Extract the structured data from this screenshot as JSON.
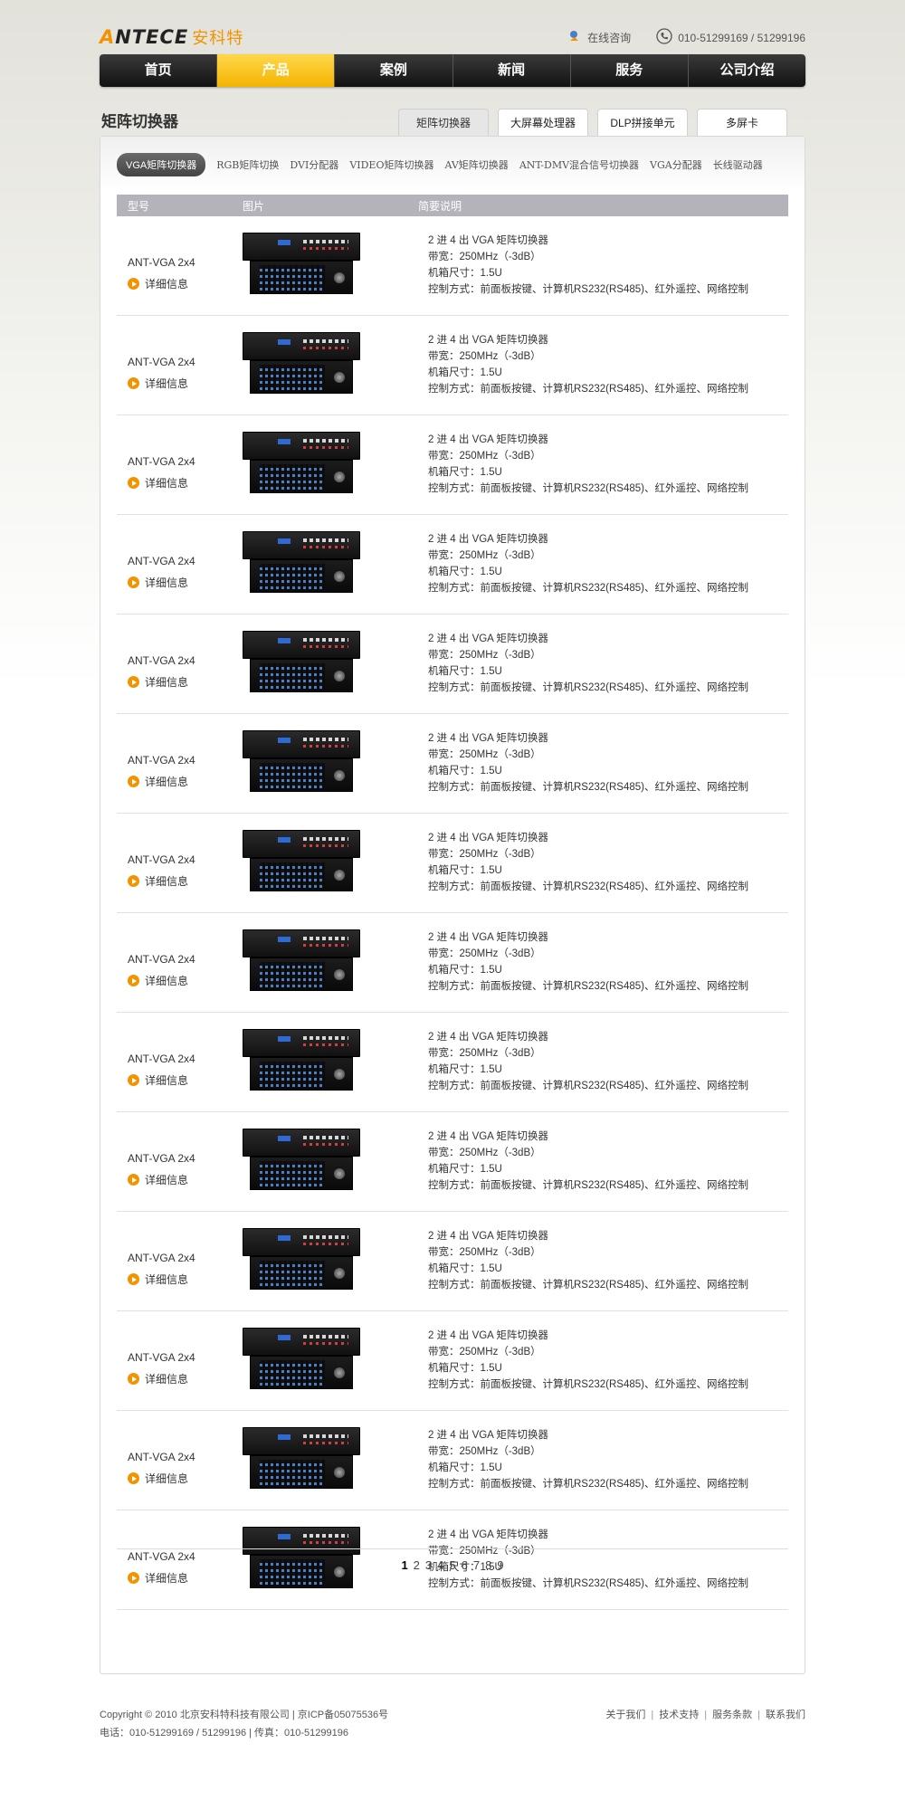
{
  "brand": {
    "logo_latin_prefix": "A",
    "logo_latin_rest": "NTECE",
    "logo_cn": "安科特"
  },
  "top": {
    "consult": "在线咨询",
    "phone": "010-51299169 / 51299196"
  },
  "nav": [
    {
      "label": "首页",
      "active": false
    },
    {
      "label": "产品",
      "active": true
    },
    {
      "label": "案例",
      "active": false
    },
    {
      "label": "新闻",
      "active": false
    },
    {
      "label": "服务",
      "active": false
    },
    {
      "label": "公司介绍",
      "active": false
    }
  ],
  "section_title": "矩阵切换器",
  "category_tabs": [
    {
      "label": "矩阵切换器",
      "active": true
    },
    {
      "label": "大屏幕处理器",
      "active": false
    },
    {
      "label": "DLP拼接单元",
      "active": false
    },
    {
      "label": "多屏卡",
      "active": false
    }
  ],
  "subtabs": [
    {
      "label": "VGA矩阵切换器",
      "active": true
    },
    {
      "label": "RGB矩阵切换",
      "active": false
    },
    {
      "label": "DVI分配器",
      "active": false
    },
    {
      "label": "VIDEO矩阵切换器",
      "active": false
    },
    {
      "label": "AV矩阵切换器",
      "active": false
    },
    {
      "label": "ANT-DMV混合信号切换器",
      "active": false
    },
    {
      "label": "VGA分配器",
      "active": false
    },
    {
      "label": "长线驱动器",
      "active": false
    }
  ],
  "table": {
    "headers": {
      "model": "型号",
      "image": "图片",
      "desc": "简要说明"
    },
    "detail_label": "详细信息",
    "rows": [
      {
        "model": "ANT-VGA 2x4",
        "desc": [
          "2 进 4 出 VGA 矩阵切换器",
          "带宽：250MHz（-3dB）",
          "机箱尺寸：1.5U",
          "控制方式：前面板按键、计算机RS232(RS485)、红外遥控、网络控制"
        ]
      },
      {
        "model": "ANT-VGA 2x4",
        "desc": [
          "2 进 4 出 VGA 矩阵切换器",
          "带宽：250MHz（-3dB）",
          "机箱尺寸：1.5U",
          "控制方式：前面板按键、计算机RS232(RS485)、红外遥控、网络控制"
        ]
      },
      {
        "model": "ANT-VGA 2x4",
        "desc": [
          "2 进 4 出 VGA 矩阵切换器",
          "带宽：250MHz（-3dB）",
          "机箱尺寸：1.5U",
          "控制方式：前面板按键、计算机RS232(RS485)、红外遥控、网络控制"
        ]
      },
      {
        "model": "ANT-VGA 2x4",
        "desc": [
          "2 进 4 出 VGA 矩阵切换器",
          "带宽：250MHz（-3dB）",
          "机箱尺寸：1.5U",
          "控制方式：前面板按键、计算机RS232(RS485)、红外遥控、网络控制"
        ]
      },
      {
        "model": "ANT-VGA 2x4",
        "desc": [
          "2 进 4 出 VGA 矩阵切换器",
          "带宽：250MHz（-3dB）",
          "机箱尺寸：1.5U",
          "控制方式：前面板按键、计算机RS232(RS485)、红外遥控、网络控制"
        ]
      },
      {
        "model": "ANT-VGA 2x4",
        "desc": [
          "2 进 4 出 VGA 矩阵切换器",
          "带宽：250MHz（-3dB）",
          "机箱尺寸：1.5U",
          "控制方式：前面板按键、计算机RS232(RS485)、红外遥控、网络控制"
        ]
      },
      {
        "model": "ANT-VGA 2x4",
        "desc": [
          "2 进 4 出 VGA 矩阵切换器",
          "带宽：250MHz（-3dB）",
          "机箱尺寸：1.5U",
          "控制方式：前面板按键、计算机RS232(RS485)、红外遥控、网络控制"
        ]
      },
      {
        "model": "ANT-VGA 2x4",
        "desc": [
          "2 进 4 出 VGA 矩阵切换器",
          "带宽：250MHz（-3dB）",
          "机箱尺寸：1.5U",
          "控制方式：前面板按键、计算机RS232(RS485)、红外遥控、网络控制"
        ]
      },
      {
        "model": "ANT-VGA 2x4",
        "desc": [
          "2 进 4 出 VGA 矩阵切换器",
          "带宽：250MHz（-3dB）",
          "机箱尺寸：1.5U",
          "控制方式：前面板按键、计算机RS232(RS485)、红外遥控、网络控制"
        ]
      },
      {
        "model": "ANT-VGA 2x4",
        "desc": [
          "2 进 4 出 VGA 矩阵切换器",
          "带宽：250MHz（-3dB）",
          "机箱尺寸：1.5U",
          "控制方式：前面板按键、计算机RS232(RS485)、红外遥控、网络控制"
        ]
      },
      {
        "model": "ANT-VGA 2x4",
        "desc": [
          "2 进 4 出 VGA 矩阵切换器",
          "带宽：250MHz（-3dB）",
          "机箱尺寸：1.5U",
          "控制方式：前面板按键、计算机RS232(RS485)、红外遥控、网络控制"
        ]
      },
      {
        "model": "ANT-VGA 2x4",
        "desc": [
          "2 进 4 出 VGA 矩阵切换器",
          "带宽：250MHz（-3dB）",
          "机箱尺寸：1.5U",
          "控制方式：前面板按键、计算机RS232(RS485)、红外遥控、网络控制"
        ]
      },
      {
        "model": "ANT-VGA 2x4",
        "desc": [
          "2 进 4 出 VGA 矩阵切换器",
          "带宽：250MHz（-3dB）",
          "机箱尺寸：1.5U",
          "控制方式：前面板按键、计算机RS232(RS485)、红外遥控、网络控制"
        ]
      },
      {
        "model": "ANT-VGA 2x4",
        "desc": [
          "2 进 4 出 VGA 矩阵切换器",
          "带宽：250MHz（-3dB）",
          "机箱尺寸：1.5U",
          "控制方式：前面板按键、计算机RS232(RS485)、红外遥控、网络控制"
        ]
      }
    ]
  },
  "pagination": {
    "pages": [
      "1",
      "2",
      "3",
      "4",
      "5",
      "6",
      "7",
      "8",
      "9"
    ],
    "current": "1"
  },
  "footer": {
    "line1": "Copyright © 2010 北京安科特科技有限公司 | 京ICP备05075536号",
    "line2": "电话：010-51299169 / 51299196 | 传真：010-51299196",
    "links": [
      "关于我们",
      "技术支持",
      "服务条款",
      "联系我们"
    ]
  },
  "colors": {
    "accent": "#f29400",
    "nav_active": "#f4b400",
    "table_header": "#b4b3bb"
  }
}
